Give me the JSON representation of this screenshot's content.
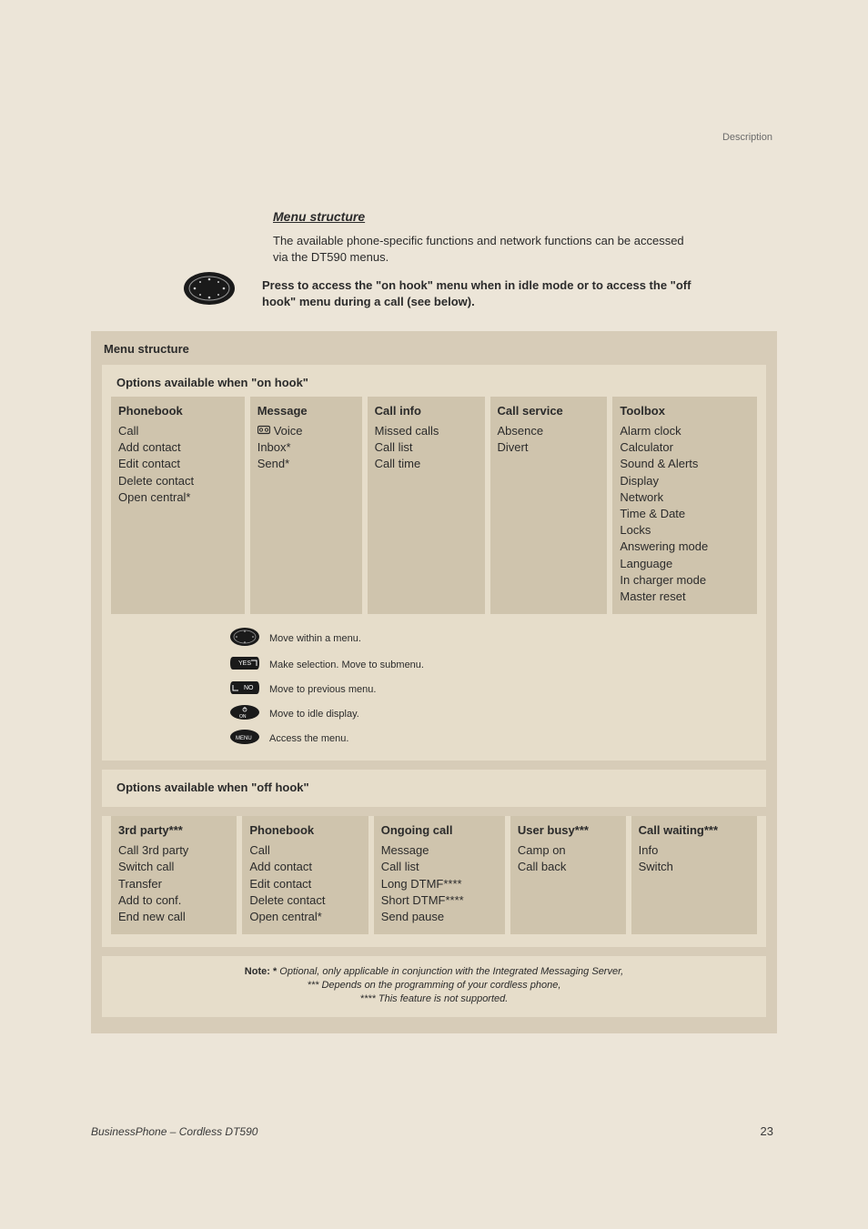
{
  "doc_label": "Description",
  "section_title": "Menu structure",
  "intro": "The available phone-specific functions and network functions can be accessed via the DT590 menus.",
  "press_text": "Press to access the \"on hook\" menu when in idle mode or to access the \"off hook\" menu during a call (see below).",
  "panel_title": "Menu structure",
  "onhook": {
    "title": "Options available when \"on hook\"",
    "cols": {
      "phonebook": {
        "header": "Phonebook",
        "items": [
          "Call",
          "Add contact",
          "Edit contact",
          "Delete contact",
          "Open central*"
        ]
      },
      "message": {
        "header": "Message",
        "items": [
          "Voice",
          "Inbox*",
          "Send*"
        ]
      },
      "callinfo": {
        "header": "Call info",
        "items": [
          "Missed calls",
          "Call list",
          "Call time"
        ]
      },
      "callservice": {
        "header": "Call service",
        "items": [
          "Absence",
          "Divert"
        ]
      },
      "toolbox": {
        "header": "Toolbox",
        "items": [
          "Alarm clock",
          "Calculator",
          "Sound & Alerts",
          "Display",
          "Network",
          "Time & Date",
          "Locks",
          "Answering mode",
          "Language",
          "In charger mode",
          "Master reset"
        ]
      }
    },
    "legend": {
      "nav": "Move within a menu.",
      "yes": "Make selection. Move to submenu.",
      "no": "Move to previous menu.",
      "on": "Move to idle display.",
      "menu": "Access the menu."
    }
  },
  "offhook": {
    "title": "Options available when \"off hook\"",
    "cols": {
      "thirdparty": {
        "header": "3rd party***",
        "items": [
          "Call 3rd party",
          "Switch call",
          "Transfer",
          "Add to conf.",
          "End new call"
        ]
      },
      "phonebook": {
        "header": "Phonebook",
        "items": [
          "Call",
          "Add contact",
          "Edit contact",
          "Delete contact",
          "Open central*"
        ]
      },
      "ongoing": {
        "header": "Ongoing call",
        "items": [
          "Message",
          "Call list",
          "Long DTMF****",
          "Short DTMF****",
          "Send pause"
        ]
      },
      "userbusy": {
        "header": "User busy***",
        "items": [
          "Camp on",
          "Call back"
        ]
      },
      "callwaiting": {
        "header": "Call waiting***",
        "items": [
          "Info",
          "Switch"
        ]
      }
    }
  },
  "notes": {
    "lead": "Note: *",
    "line1": " Optional, only applicable in conjunction with the Integrated Messaging Server,",
    "line2": "    *** Depends on the programming of your cordless phone,",
    "line3": "**** This feature is not supported."
  },
  "footer_left": "BusinessPhone – Cordless DT590",
  "footer_right": "23"
}
